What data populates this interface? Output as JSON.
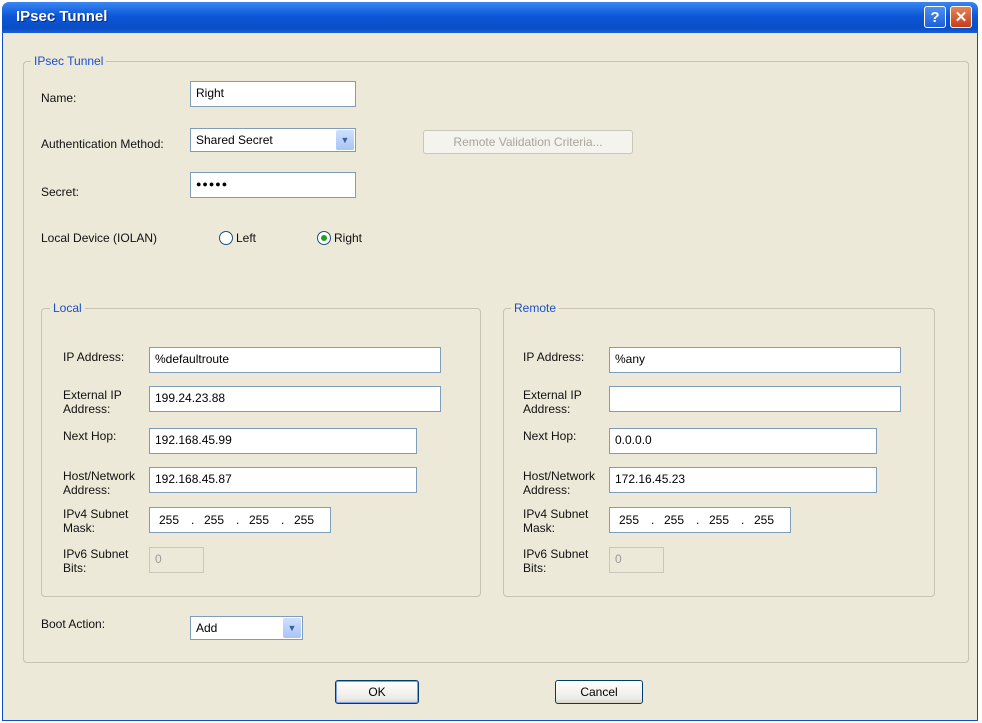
{
  "window": {
    "title": "IPsec Tunnel",
    "help_glyph": "?",
    "close_glyph": "✕"
  },
  "tunnel": {
    "legend": "IPsec Tunnel",
    "name_label": "Name:",
    "name_value": "Right",
    "auth_label": "Authentication Method:",
    "auth_value": "Shared Secret",
    "remote_validation_label": "Remote Validation Criteria...",
    "secret_label": "Secret:",
    "secret_value": "●●●●●",
    "local_device_label": "Local Device (IOLAN)",
    "radio_left_label": "Left",
    "radio_right_label": "Right",
    "selected_side": "Right"
  },
  "local": {
    "legend": "Local",
    "ip_label": "IP Address:",
    "ip_value": "%defaultroute",
    "ext_ip_label_1": "External IP",
    "ext_ip_label_2": "Address:",
    "ext_ip_value": "199.24.23.88",
    "next_hop_label": "Next Hop:",
    "next_hop_value": "192.168.45.99",
    "host_label_1": "Host/Network",
    "host_label_2": "Address:",
    "host_value": "192.168.45.87",
    "mask_label_1": "IPv4 Subnet",
    "mask_label_2": "Mask:",
    "mask_octets": [
      "255",
      "255",
      "255",
      "255"
    ],
    "v6_label_1": "IPv6 Subnet",
    "v6_label_2": "Bits:",
    "v6_value": "0"
  },
  "remote": {
    "legend": "Remote",
    "ip_label": "IP Address:",
    "ip_value": "%any",
    "ext_ip_label_1": "External IP",
    "ext_ip_label_2": "Address:",
    "ext_ip_value": "",
    "next_hop_label": "Next Hop:",
    "next_hop_value": "0.0.0.0",
    "host_label_1": "Host/Network",
    "host_label_2": "Address:",
    "host_value": "172.16.45.23",
    "mask_label_1": "IPv4 Subnet",
    "mask_label_2": "Mask:",
    "mask_octets": [
      "255",
      "255",
      "255",
      "255"
    ],
    "v6_label_1": "IPv6 Subnet",
    "v6_label_2": "Bits:",
    "v6_value": "0"
  },
  "boot": {
    "label": "Boot Action:",
    "value": "Add"
  },
  "buttons": {
    "ok": "OK",
    "cancel": "Cancel"
  },
  "icons": {
    "dropdown_arrow": "chevron-down-icon",
    "dot": "."
  },
  "colors": {
    "titlebar": "#0b57d8",
    "legend_text": "#1b4fc9",
    "dialog_bg": "#ece9d8"
  }
}
